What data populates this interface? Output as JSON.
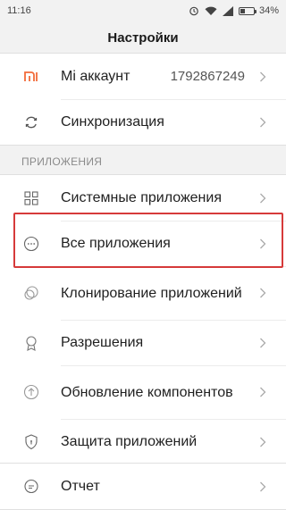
{
  "status": {
    "time": "11:16",
    "battery": "34%",
    "battery_level": 0.34
  },
  "header": {
    "title": "Настройки"
  },
  "account": [
    {
      "label": "Mi аккаунт",
      "value": "1792867249",
      "icon": "mi-logo-icon"
    },
    {
      "label": "Синхронизация",
      "icon": "sync-icon"
    }
  ],
  "apps_section": {
    "title": "ПРИЛОЖЕНИЯ",
    "items": [
      {
        "label": "Системные приложения",
        "icon": "grid-icon"
      },
      {
        "label": "Все приложения",
        "icon": "more-circle-icon"
      },
      {
        "label": "Клонирование приложений",
        "icon": "clone-icon"
      },
      {
        "label": "Разрешения",
        "icon": "badge-icon"
      },
      {
        "label": "Обновление компонентов",
        "icon": "upload-icon"
      },
      {
        "label": "Защита приложений",
        "icon": "shield-icon"
      }
    ]
  },
  "bottom": [
    {
      "label": "Отчет",
      "icon": "chat-icon"
    }
  ],
  "colors": {
    "highlight": "#d63a3a",
    "mi_orange": "#f26b3a"
  }
}
